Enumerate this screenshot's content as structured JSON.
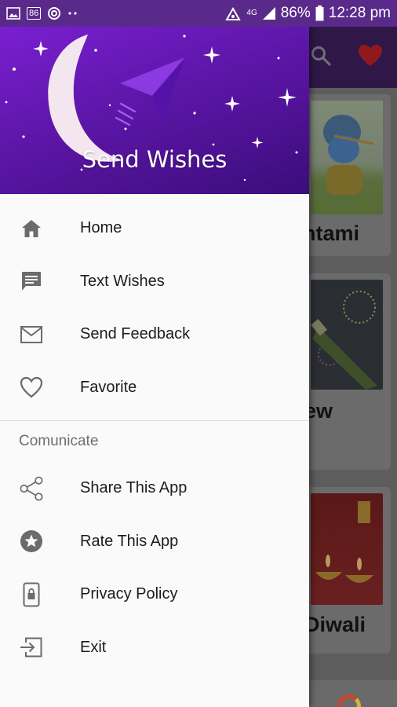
{
  "status_bar": {
    "notif_badge": "86",
    "network": "4G",
    "battery": "86%",
    "time": "12:28 pm"
  },
  "drawer": {
    "header_title": "Send Wishes",
    "main_items": [
      {
        "label": "Home",
        "icon": "home-icon"
      },
      {
        "label": "Text Wishes",
        "icon": "message-icon"
      },
      {
        "label": "Send Feedback",
        "icon": "mail-icon"
      },
      {
        "label": "Favorite",
        "icon": "heart-outline-icon"
      }
    ],
    "section_title": "Comunicate",
    "communicate_items": [
      {
        "label": "Share This App",
        "icon": "share-icon"
      },
      {
        "label": "Rate This App",
        "icon": "star-icon"
      },
      {
        "label": "Privacy Policy",
        "icon": "phone-lock-icon"
      },
      {
        "label": "Exit",
        "icon": "exit-icon"
      }
    ]
  },
  "background_app": {
    "cards": [
      "htami",
      "ew",
      "Diwali"
    ]
  },
  "colors": {
    "status_bar": "#5a2a8a",
    "header_gradient_start": "#7a1fd0",
    "header_gradient_end": "#3b0d7a",
    "favorite_heart": "#d0161c"
  }
}
